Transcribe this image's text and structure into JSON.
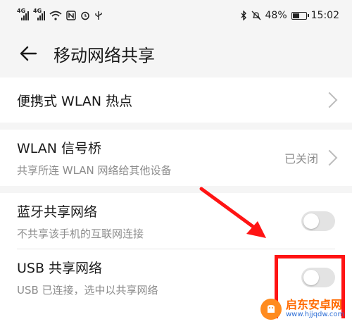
{
  "status_bar": {
    "signal1_label": "4G",
    "signal2_label": "4G",
    "battery_percent": "48%",
    "battery_level": 0.48,
    "time": "15:02",
    "icons": [
      "signal-icon",
      "signal-icon",
      "wifi-icon",
      "nfc-icon",
      "alarm-icon",
      "usb-icon",
      "bluetooth-icon",
      "mute-icon",
      "battery-icon"
    ]
  },
  "header": {
    "title": "移动网络共享"
  },
  "items": {
    "wlan_hotspot": {
      "title": "便携式 WLAN 热点"
    },
    "wlan_bridge": {
      "title": "WLAN 信号桥",
      "subtitle": "共享所连 WLAN 网络给其他设备",
      "state": "已关闭"
    },
    "bluetooth_share": {
      "title": "蓝牙共享网络",
      "subtitle": "不共享该手机的互联网连接",
      "enabled": false
    },
    "usb_share": {
      "title": "USB 共享网络",
      "subtitle": "USB 已连接，选中以共享网络",
      "enabled": false
    }
  },
  "annotation": {
    "color": "#ff1414"
  },
  "watermark": {
    "name": "启东安卓网",
    "url": "www.hjjqdw.com"
  }
}
